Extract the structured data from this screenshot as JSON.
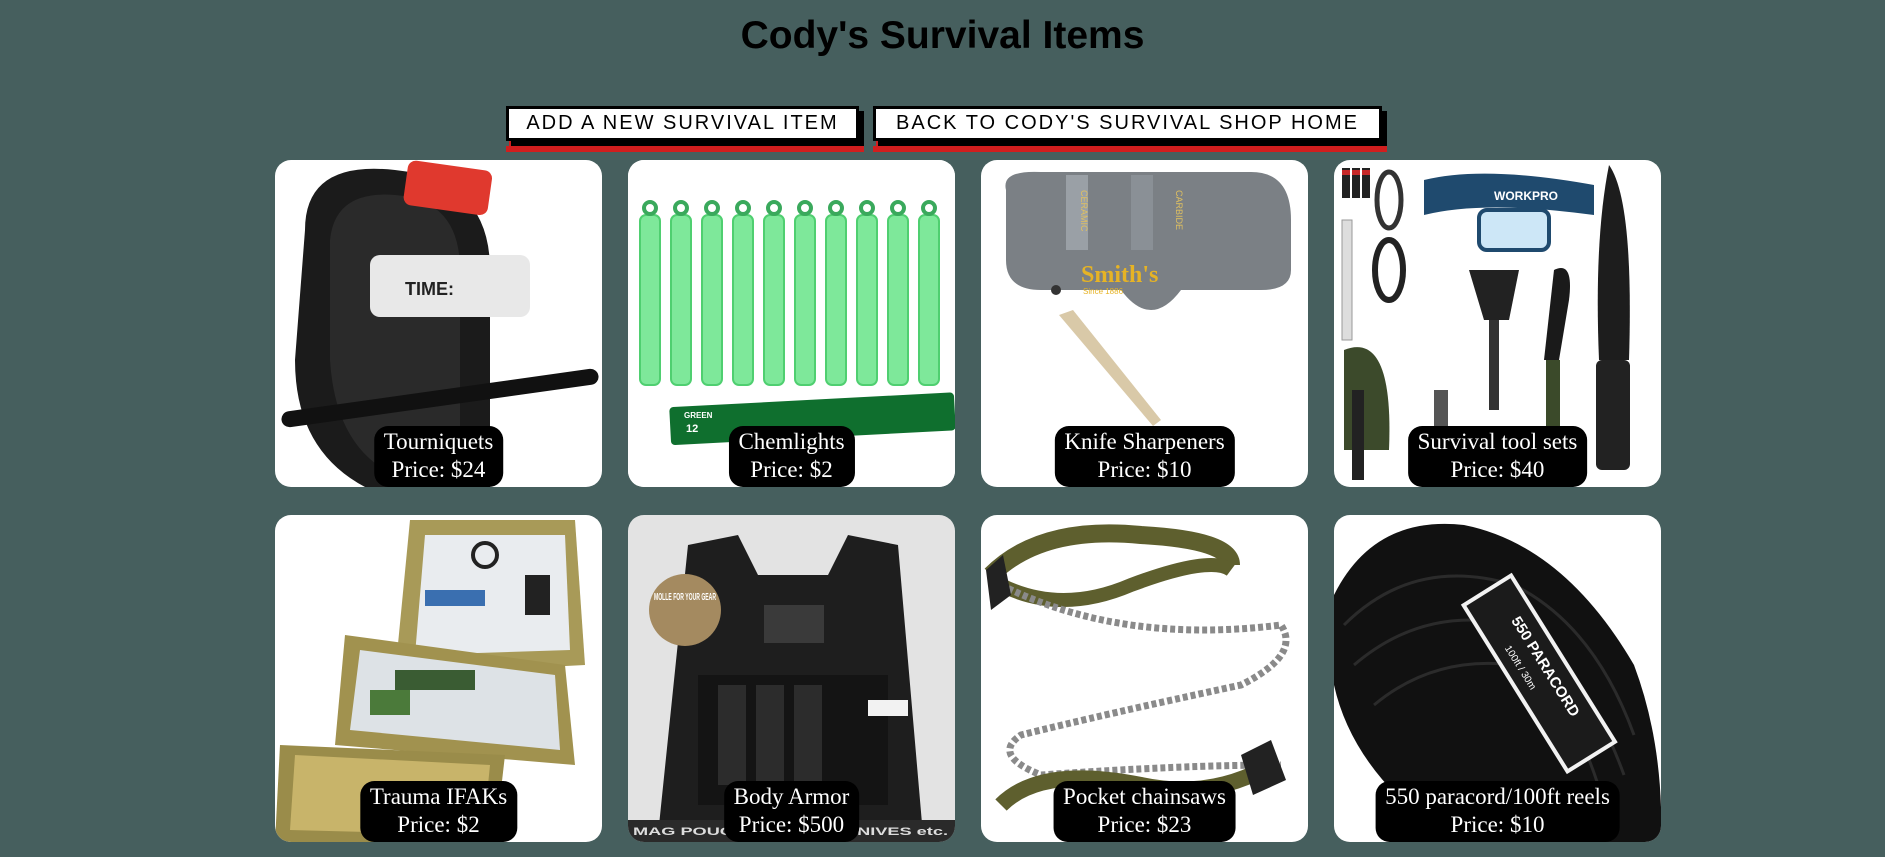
{
  "page": {
    "title": "Cody's Survival Items",
    "background_color": "#465f5e"
  },
  "actions": {
    "add_label": "ADD A NEW SURVIVAL ITEM",
    "home_label": "BACK TO CODY'S SURVIVAL SHOP HOME",
    "accent_color": "#d11e1e"
  },
  "items": [
    {
      "name": "Tourniquets",
      "price": "Price: $24",
      "image_icon": "tourniquet-icon"
    },
    {
      "name": "Chemlights",
      "price": "Price: $2",
      "image_icon": "glowstick-icon"
    },
    {
      "name": "Knife Sharpeners",
      "price": "Price: $10",
      "image_icon": "sharpener-icon"
    },
    {
      "name": "Survival tool sets",
      "price": "Price: $40",
      "image_icon": "toolset-icon"
    },
    {
      "name": "Trauma IFAKs",
      "price": "Price: $2",
      "image_icon": "first-aid-kit-icon"
    },
    {
      "name": "Body Armor",
      "price": "Price: $500",
      "image_icon": "plate-carrier-icon"
    },
    {
      "name": "Pocket chainsaws",
      "price": "Price: $23",
      "image_icon": "chainsaw-icon"
    },
    {
      "name": "550 paracord/100ft reels",
      "price": "Price: $10",
      "image_icon": "paracord-icon"
    }
  ],
  "image_text": {
    "tourniquet_tag": "TIME:",
    "sharpener_brand": "Smith's",
    "sharpener_since": "Since 1886",
    "sharpener_left": "CERAMIC",
    "sharpener_right": "CARBIDE",
    "glowstick_color": "GREEN",
    "glowstick_hours": "12",
    "headlamp_brand": "WORKPRO",
    "armor_badge": "MOLLE FOR YOUR GEAR",
    "armor_footer": "MAG POUCHES / ... TS / KNIVES etc.",
    "paracord_title": "550 PARACORD",
    "paracord_length": "100ft / 30m"
  }
}
